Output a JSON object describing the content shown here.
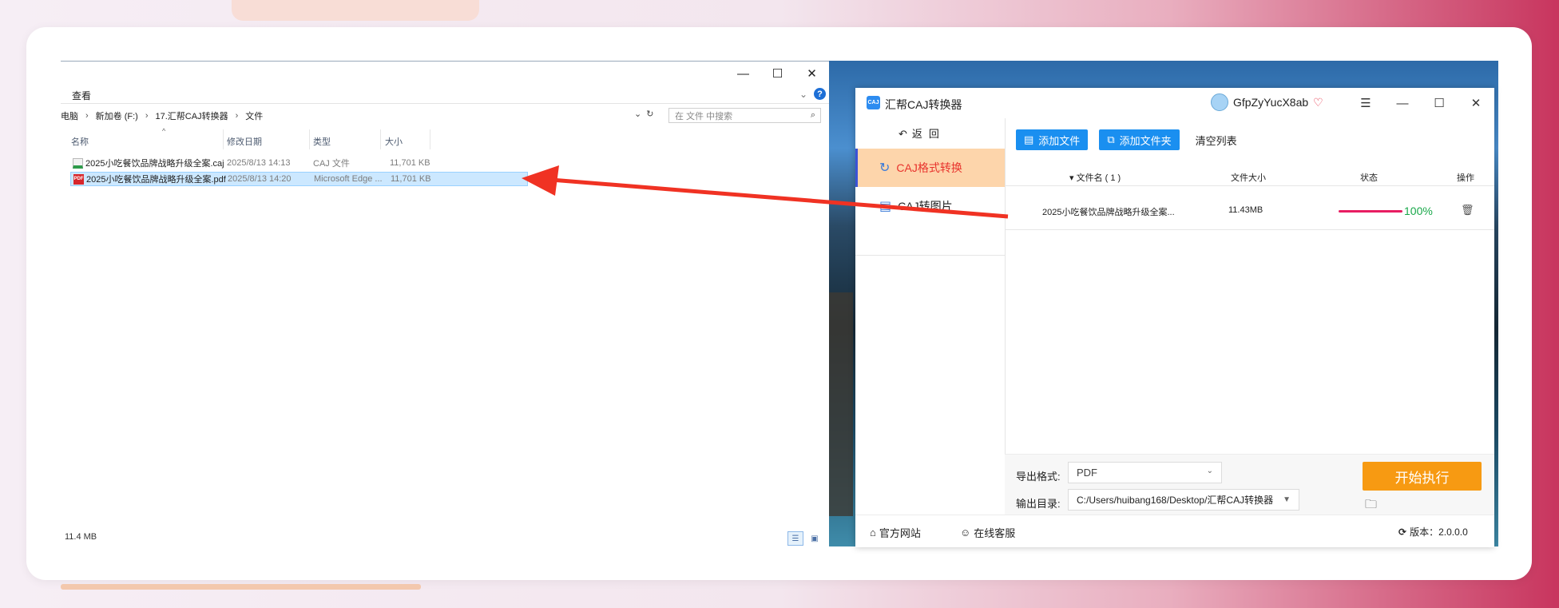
{
  "explorer": {
    "window_controls": {
      "minimize": "—",
      "maximize": "☐",
      "close": "✕"
    },
    "ribbon_tab": "查看",
    "ribbon_expand": "⌄",
    "help": "?",
    "breadcrumb": [
      "电脑",
      "新加卷 (F:)",
      "17.汇帮CAJ转换器",
      "文件"
    ],
    "breadcrumb_sep": "›",
    "address_dropdown": "⌄",
    "refresh": "↻",
    "search_placeholder": "在 文件 中搜索",
    "search_icon": "⌕",
    "sort_caret": "^",
    "columns": {
      "name": "名称",
      "date": "修改日期",
      "type": "类型",
      "size": "大小"
    },
    "files": [
      {
        "name": "2025小吃餐饮品牌战略升级全案.caj",
        "date": "2025/8/13 14:13",
        "type": "CAJ 文件",
        "size": "11,701 KB",
        "icon": "caj-file-icon",
        "selected": false
      },
      {
        "name": "2025小吃餐饮品牌战略升级全案.pdf",
        "date": "2025/8/13 14:20",
        "type": "Microsoft Edge ...",
        "size": "11,701 KB",
        "icon": "pdf-file-icon",
        "selected": true
      }
    ],
    "pdf_badge": "PDF",
    "status": "11.4 MB"
  },
  "app": {
    "logo_text": "CAJ",
    "title": "汇帮CAJ转换器",
    "username": "GfpZyYucX8ab",
    "vip_icon": "♡",
    "window_controls": {
      "menu": "☰",
      "minimize": "—",
      "maximize": "☐",
      "close": "✕"
    },
    "back": "返回",
    "back_icon": "↶",
    "sidebar": [
      {
        "label": "CAJ格式转换",
        "icon": "↻",
        "active": true
      },
      {
        "label": "CAJ转图片",
        "icon": "▤",
        "active": false
      }
    ],
    "toolbar": {
      "add_file": "添加文件",
      "add_folder": "添加文件夹",
      "clear_list": "清空列表"
    },
    "table_headers": {
      "filename": "▾ 文件名 ( 1 )",
      "filesize": "文件大小",
      "status": "状态",
      "action": "操作"
    },
    "row": {
      "filename": "2025小吃餐饮品牌战略升级全案...",
      "size": "11.43MB",
      "progress": 1.0,
      "progress_text": "100%",
      "trash": "🗑"
    },
    "export_format_label": "导出格式:",
    "export_format_value": "PDF",
    "output_dir_label": "输出目录:",
    "output_dir_value": "C:/Users/huibang168/Desktop/汇帮CAJ转换器",
    "start_button": "开始执行",
    "footer": {
      "website": "官方网站",
      "support": "在线客服",
      "version": "版本：2.0.0.0",
      "home_icon": "⌂",
      "support_icon": "☺",
      "update_icon": "⟳"
    }
  },
  "colors": {
    "accent_blue": "#1a8ff0",
    "active_bg": "#fdd5ab",
    "active_text": "#e8332d",
    "start_orange": "#f79a12",
    "progress_pink": "#e81d62",
    "arrow_red": "#f03223"
  }
}
